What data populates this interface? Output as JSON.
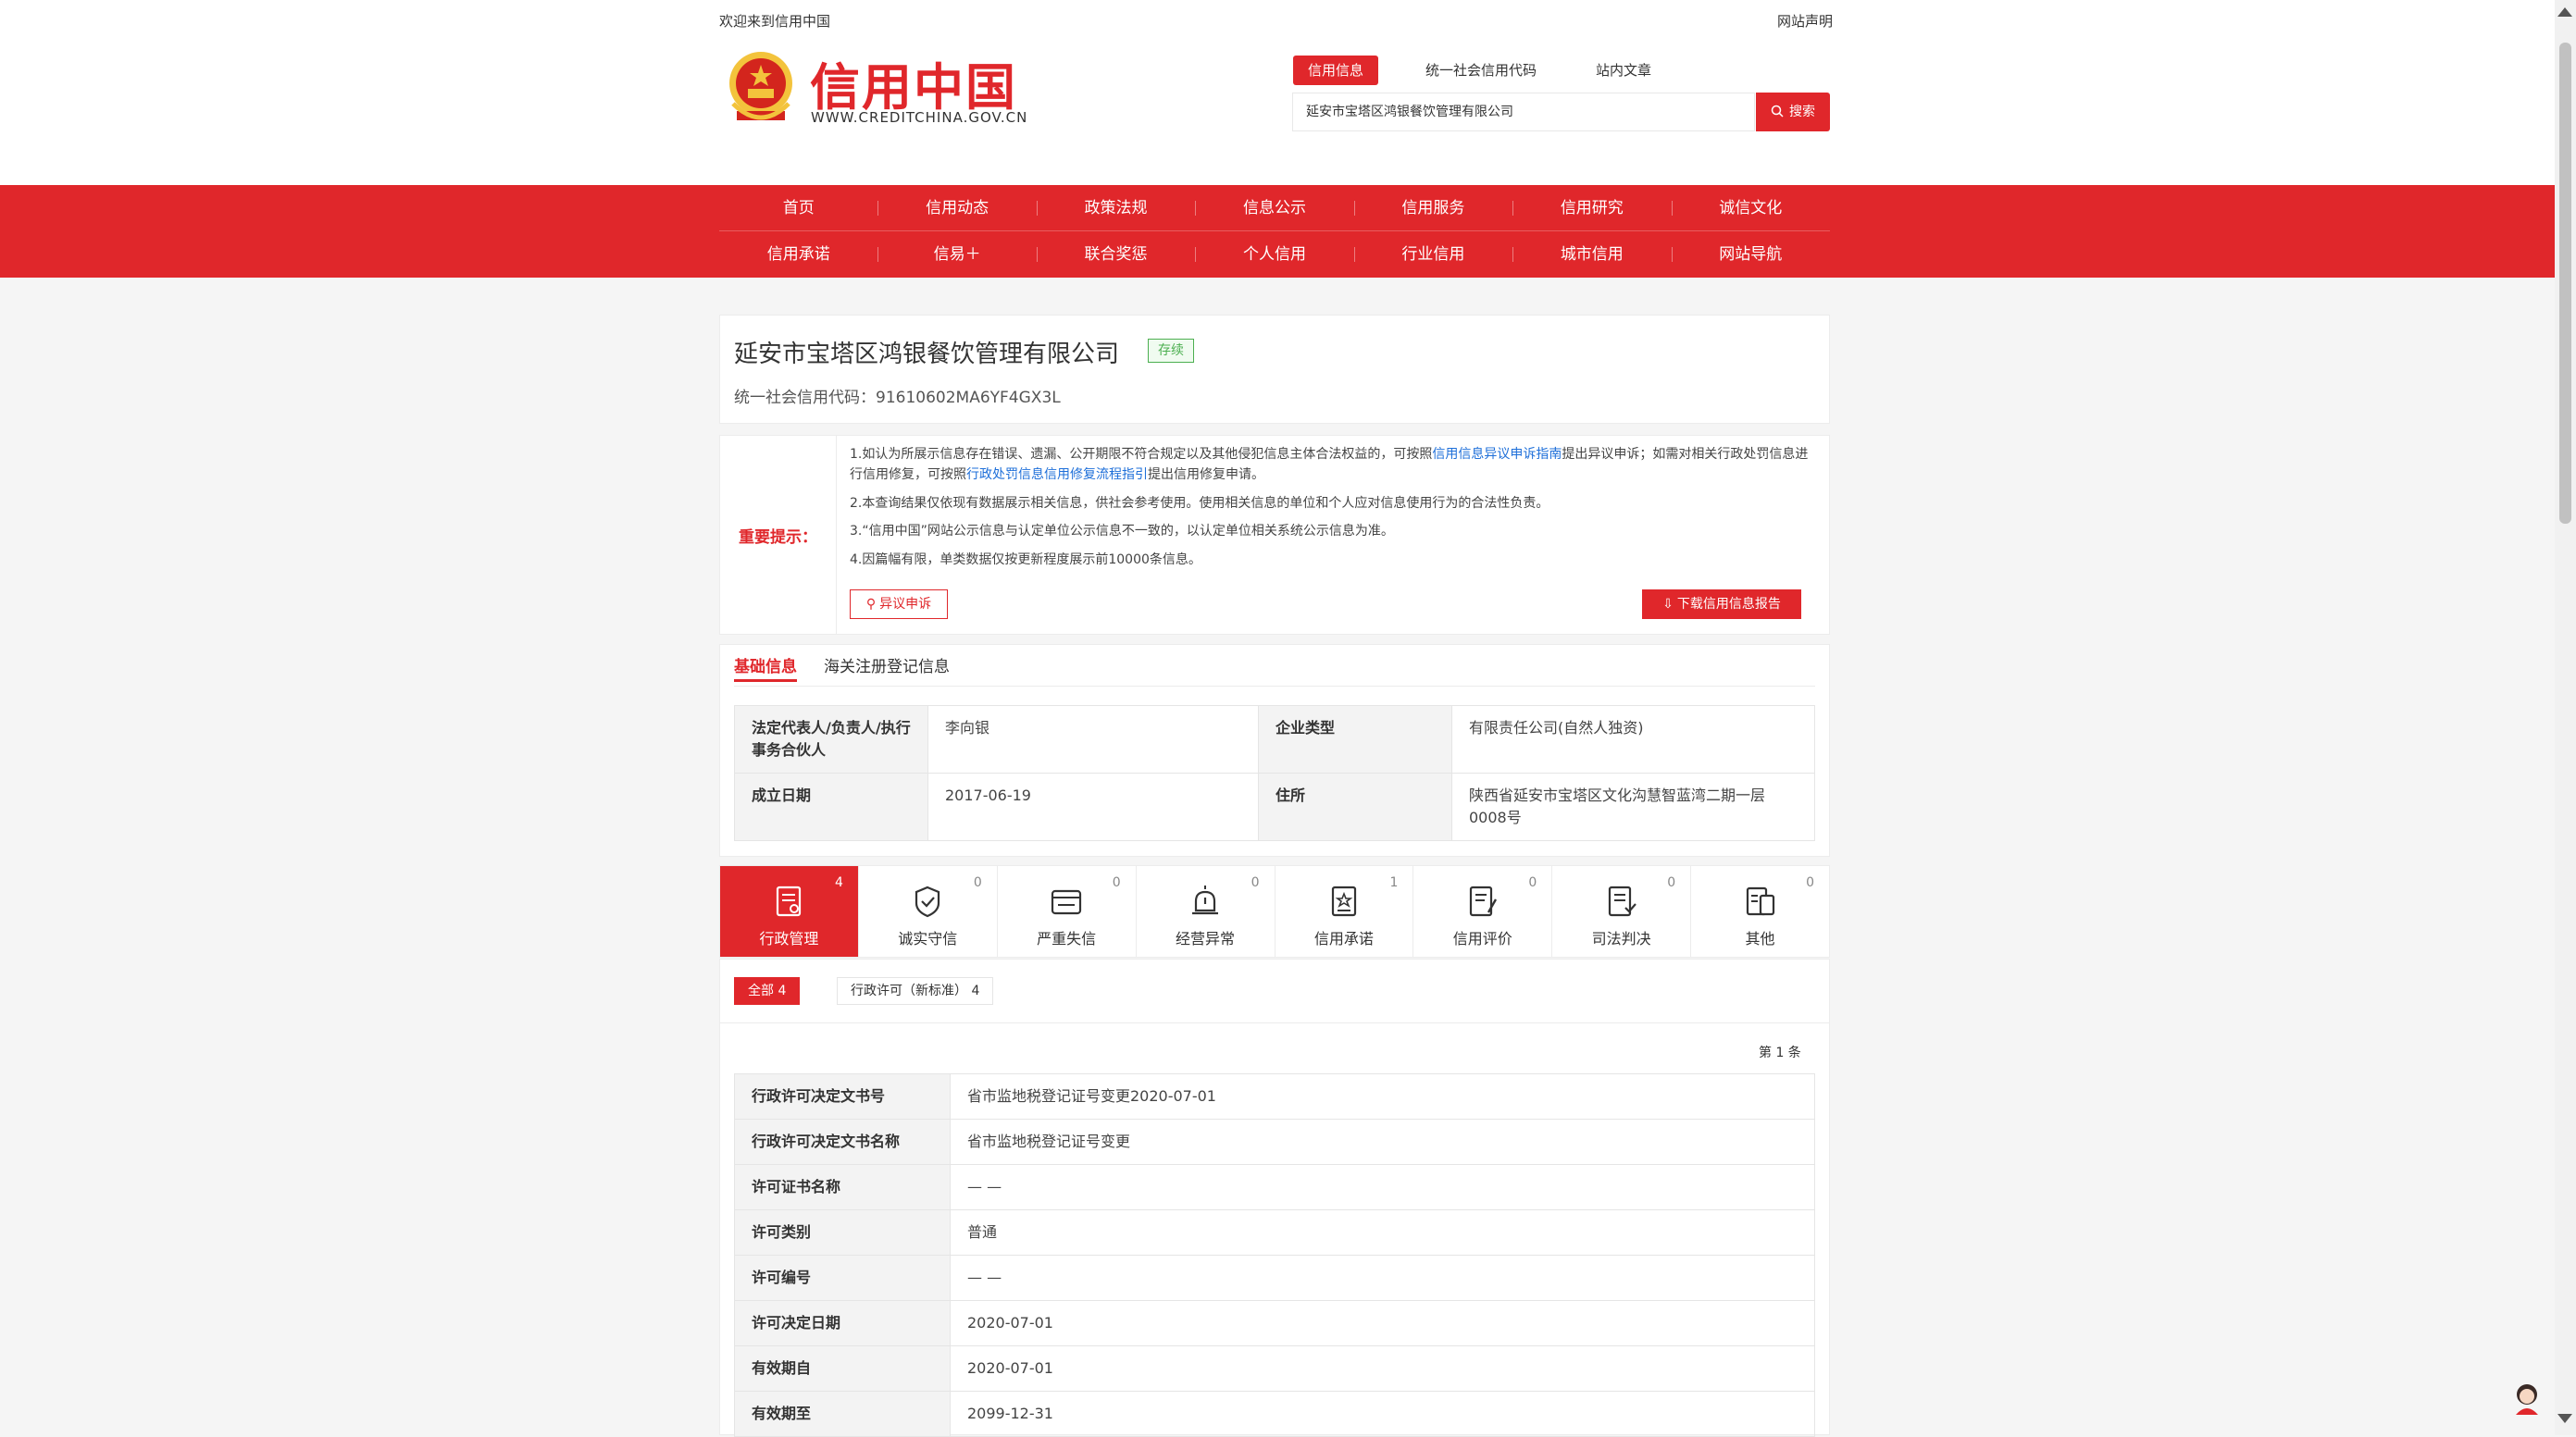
{
  "header": {
    "welcome": "欢迎来到信用中国",
    "statement": "网站声明",
    "logo_text": "信用中国",
    "logo_url": "WWW.CREDITCHINA.GOV.CN"
  },
  "search": {
    "tabs": [
      "信用信息",
      "统一社会信用代码",
      "站内文章"
    ],
    "value": "延安市宝塔区鸿银餐饮管理有限公司",
    "button": "搜索"
  },
  "nav": {
    "row1": [
      "首页",
      "信用动态",
      "政策法规",
      "信息公示",
      "信用服务",
      "信用研究",
      "诚信文化"
    ],
    "row2": [
      "信用承诺",
      "信易＋",
      "联合奖惩",
      "个人信用",
      "行业信用",
      "城市信用",
      "网站导航"
    ]
  },
  "company": {
    "name": "延安市宝塔区鸿银餐饮管理有限公司",
    "status": "存续",
    "credit_code": "统一社会信用代码：91610602MA6YF4GX3L"
  },
  "notice": {
    "label": "重要提示：",
    "p1a": "1.如认为所展示信息存在错误、遗漏、公开期限不符合规定以及其他侵犯信息主体合法权益的，可按照",
    "p1link1": "信用信息异议申诉指南",
    "p1b": "提出异议申诉；如需对相关行政处罚信息进行信用修复，可按照",
    "p1link2": "行政处罚信息信用修复流程指引",
    "p1c": "提出信用修复申请。",
    "p2": "2.本查询结果仅依现有数据展示相关信息，供社会参考使用。使用相关信息的单位和个人应对信息使用行为的合法性负责。",
    "p3": "3.“信用中国”网站公示信息与认定单位公示信息不一致的，以认定单位相关系统公示信息为准。",
    "p4": "4.因篇幅有限，单类数据仅按更新程度展示前10000条信息。",
    "objection_btn": "异议申诉",
    "download_btn": "下载信用信息报告"
  },
  "info_tabs": [
    "基础信息",
    "海关注册登记信息"
  ],
  "basic_info": {
    "legal_rep_label": "法定代表人/负责人/执行事务合伙人",
    "legal_rep": "李向银",
    "type_label": "企业类型",
    "type": "有限责任公司(自然人独资)",
    "date_label": "成立日期",
    "date": "2017-06-19",
    "address_label": "住所",
    "address": "陕西省延安市宝塔区文化沟慧智蓝湾二期一层0008号"
  },
  "categories": [
    {
      "label": "行政管理",
      "count": "4",
      "icon": "admin-management-icon"
    },
    {
      "label": "诚实守信",
      "count": "0",
      "icon": "honesty-icon"
    },
    {
      "label": "严重失信",
      "count": "0",
      "icon": "serious-dishonesty-icon"
    },
    {
      "label": "经营异常",
      "count": "0",
      "icon": "business-abnormal-icon"
    },
    {
      "label": "信用承诺",
      "count": "1",
      "icon": "credit-commitment-icon"
    },
    {
      "label": "信用评价",
      "count": "0",
      "icon": "credit-evaluation-icon"
    },
    {
      "label": "司法判决",
      "count": "0",
      "icon": "judicial-judgment-icon"
    },
    {
      "label": "其他",
      "count": "0",
      "icon": "other-icon"
    }
  ],
  "filters": {
    "all": "全部  4",
    "license": "行政许可（新标准）  4"
  },
  "page_count": "第 1 条",
  "license": {
    "rows": [
      {
        "k": "行政许可决定文书号",
        "v": "省市监地税登记证号变更2020-07-01"
      },
      {
        "k": "行政许可决定文书名称",
        "v": "省市监地税登记证号变更"
      },
      {
        "k": "许可证书名称",
        "v": "— —"
      },
      {
        "k": "许可类别",
        "v": "普通"
      },
      {
        "k": "许可编号",
        "v": "— —"
      },
      {
        "k": "许可决定日期",
        "v": "2020-07-01"
      },
      {
        "k": "有效期自",
        "v": "2020-07-01"
      },
      {
        "k": "有效期至",
        "v": "2099-12-31"
      }
    ]
  },
  "colors": {
    "brand_red": "#e0272b",
    "status_green": "#4caf50",
    "link_blue": "#1e6fd9"
  }
}
